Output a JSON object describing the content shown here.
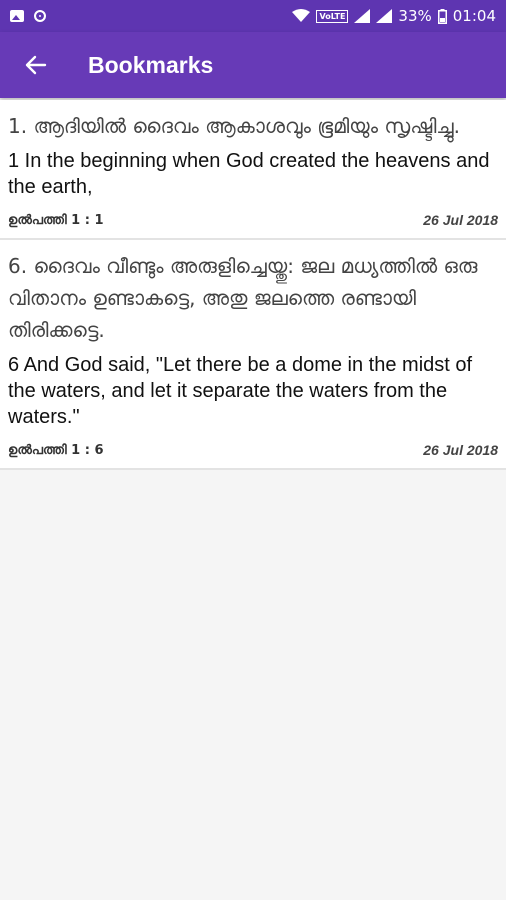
{
  "status_bar": {
    "volte": "VoLTE",
    "battery": "33%",
    "time": "01:04"
  },
  "app_bar": {
    "title": "Bookmarks",
    "back_icon": "arrow-left-icon"
  },
  "bookmarks": [
    {
      "malayalam": "1. ആദിയിൽ ദൈവം ആകാശവും ഭൂമിയും സൃഷ്ടിച്ചു.",
      "english": "1 In the beginning when God created the heavens and the earth,",
      "reference": "ഉൽപത്തി 1 : 1",
      "date": "26 Jul 2018"
    },
    {
      "malayalam": "6. ദൈവം വീണ്ടും അരുളിച്ചെയ്തു: ജല മധ്യത്തിൽ ഒരു വിതാനം ഉണ്ടാകട്ടെ, അതു ജലത്തെ രണ്ടായി തിരിക്കട്ടെ.",
      "english": "6 And God said, \"Let there be a dome in the midst of the waters, and let it separate the waters from the waters.\"",
      "reference": "ഉൽപത്തി 1 : 6",
      "date": "26 Jul 2018"
    }
  ],
  "colors": {
    "status_bar": "#5e35b1",
    "app_bar": "#673ab7",
    "background": "#f5f5f5"
  }
}
